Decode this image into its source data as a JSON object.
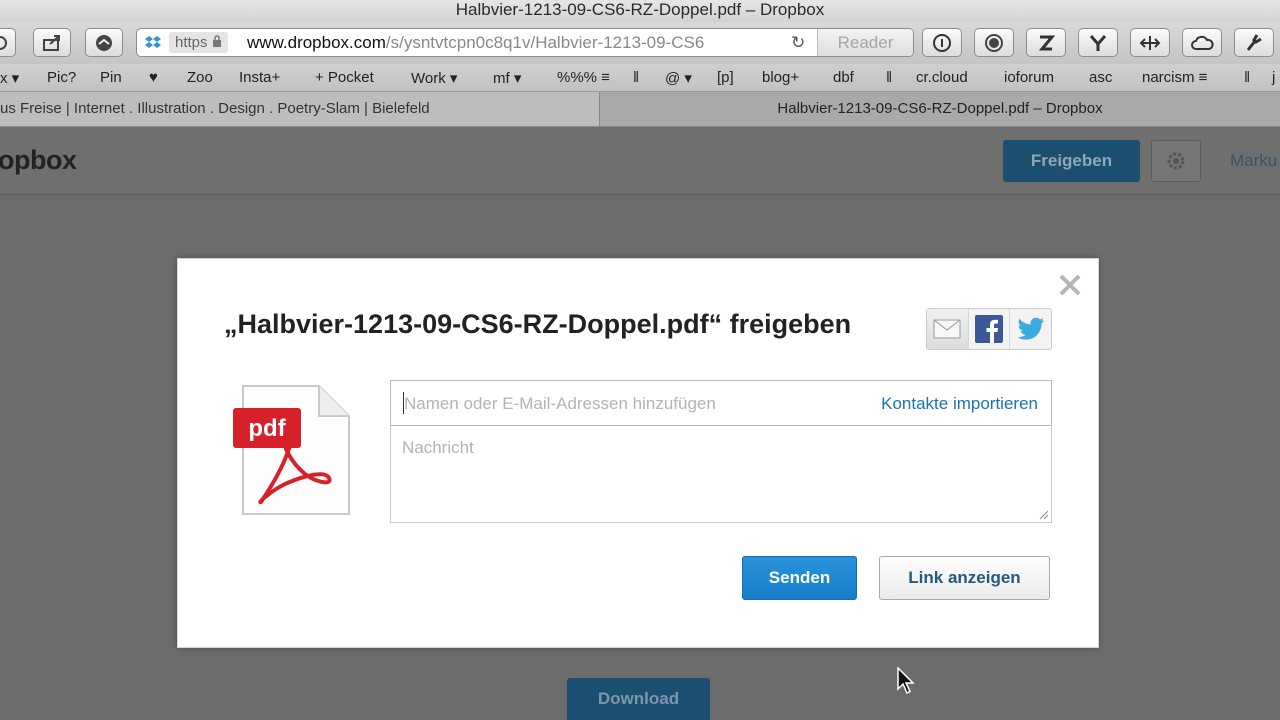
{
  "window": {
    "title": "Halbvier-1213-09-CS6-RZ-Doppel.pdf – Dropbox"
  },
  "addressbar": {
    "scheme_badge": "https",
    "domain": "www.dropbox.com",
    "path": "/s/ysntvtcpn0c8q1v/Halbvier-1213-09-CS6",
    "reader_label": "Reader"
  },
  "bookmarks": [
    "x ▾",
    "Pic?",
    "Pin",
    "♥",
    "Zoo",
    "Insta+",
    "+ Pocket",
    "Work ▾",
    "mf ▾",
    "%%% ≡",
    "‖",
    "@ ▾",
    "[p]",
    "blog+",
    "dbf",
    "‖",
    "cr.cloud",
    "ioforum",
    "asc",
    "narcism ≡",
    "‖",
    "j"
  ],
  "tabs": [
    {
      "label": "us Freise | Internet . Illustration . Design . Poetry-Slam | Bielefeld"
    },
    {
      "label": "Halbvier-1213-09-CS6-RZ-Doppel.pdf – Dropbox"
    }
  ],
  "page": {
    "logo": "opbox",
    "share_label": "Freigeben",
    "mark_label": "Marku",
    "download_label": "Download"
  },
  "modal": {
    "title": "„Halbvier-1213-09-CS6-RZ-Doppel.pdf“ freigeben",
    "recipients_placeholder": "Namen oder E-Mail-Adressen hinzufügen",
    "import_contacts_label": "Kontakte importieren",
    "message_placeholder": "Nachricht",
    "send_label": "Senden",
    "show_link_label": "Link anzeigen",
    "file_type_label": "pdf",
    "social_icons": [
      "email-icon",
      "facebook-icon",
      "twitter-icon"
    ]
  },
  "colors": {
    "accent_blue": "#1a73b8",
    "send_button": "#1f88d2",
    "pdf_red": "#d6212b"
  }
}
